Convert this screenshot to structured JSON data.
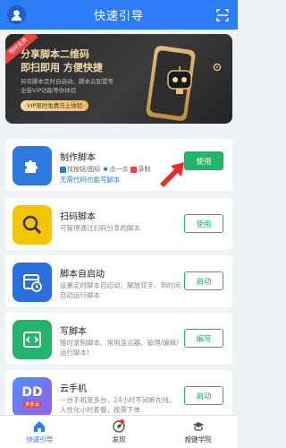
{
  "header": {
    "title": "快速引导",
    "avatar_icon": "user-avatar-icon",
    "scan_icon": "scan-icon"
  },
  "banner": {
    "ribbon": "限时免费",
    "headline_1": "分享脚本二维码",
    "headline_2": "即扫即用 方便快捷",
    "subtext_1": "另有脚本定时自启动、脚本云配置等",
    "subtext_2": "全新VIP功能等你体验",
    "cta": "VIP限时免费马上体验"
  },
  "cards": [
    {
      "name": "制作脚本",
      "tags": [
        "找按钮/图标",
        "点一点",
        "录制"
      ],
      "subtitle": "无需代码也能写脚本",
      "button": "使用",
      "icon": "puzzle-icon",
      "color": "#2a7be0"
    },
    {
      "name": "扫码脚本",
      "desc": "可管理通过扫码分享的脚本",
      "button": "使用",
      "icon": "magnifier-icon",
      "color": "#f5c400"
    },
    {
      "name": "脚本自启动",
      "desc": "设置定时脚本自启动，解放双手，到时间自动运行脚本",
      "button": "启动",
      "icon": "schedule-icon",
      "color": "#2a6fe0"
    },
    {
      "name": "写脚本",
      "desc": "随时录制脚本、常用连点器、管理/编辑/运行脚本!",
      "button": "编写",
      "icon": "code-icon",
      "color": "#22b56b"
    },
    {
      "name": "云手机",
      "desc": "一台手机变多台，24小时不间断在线。人性化小时套餐，按需下单",
      "button": "启动",
      "icon": "dd-cloud-phone-icon",
      "badge": "多多云",
      "color": "#7a5cf0"
    }
  ],
  "tabs": [
    {
      "label": "快速引导",
      "icon": "home-icon",
      "active": true
    },
    {
      "label": "发现",
      "icon": "discover-icon",
      "active": false,
      "badge_dot": true
    },
    {
      "label": "按键学院",
      "icon": "academy-icon",
      "active": false
    }
  ],
  "colors": {
    "primary": "#2b7cf6",
    "green": "#24b56c",
    "arrow": "#e82b2b"
  }
}
